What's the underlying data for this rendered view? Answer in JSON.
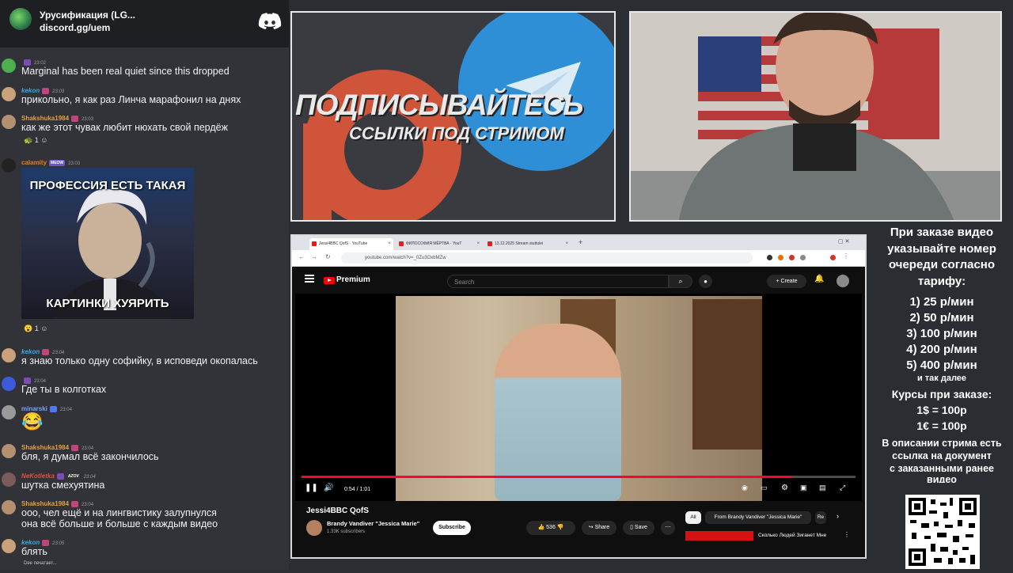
{
  "discord": {
    "server_name": "Урусификация (LG...",
    "server_link": "discord.gg/uem",
    "messages": [
      {
        "user": "",
        "time": "23:02",
        "text": "Marginal has been real quiet since this dropped",
        "user_color": "#3ba55d"
      },
      {
        "user": "kekon",
        "time": "23:03",
        "text": "прикольно, я как раз Линча марафонил на днях",
        "user_color": "#3aa7e6"
      },
      {
        "user": "Shakshuka1984",
        "time": "23:03",
        "text": "как же этот чувак любит нюхать свой пердёж",
        "user_color": "#e6a23a",
        "reaction_count": "1"
      },
      {
        "user": "calamity",
        "badge": "MEOW",
        "time": "23:03",
        "text": "",
        "user_color": "#e67e22",
        "reaction_count": "1"
      },
      {
        "user": "kekon",
        "time": "23:04",
        "text": "я знаю только одну софийку, в исповеди окопалась",
        "user_color": "#3aa7e6"
      },
      {
        "user": "",
        "time": "23:04",
        "text": "Где ты в колготках",
        "user_color": "#dcddde"
      },
      {
        "user": "minarski",
        "time": "23:04",
        "text": "😂",
        "user_color": "#7aa2ff"
      },
      {
        "user": "Shakshuka1984",
        "time": "23:04",
        "text": "бля, я думал всё закончилось",
        "user_color": "#e6a23a"
      },
      {
        "user": "NeKotletka",
        "badge": "AZOV",
        "time": "23:04",
        "text": "шутка смехуятина",
        "user_color": "#e74c3c"
      },
      {
        "user": "Shakshuka1984",
        "time": "23:04",
        "text": "ооо, чел ещё и на лингвистику залупнулся",
        "text2": "она всё больше и больше с каждым видео",
        "user_color": "#e6a23a"
      },
      {
        "user": "kekon",
        "time": "23:05",
        "text": "блять",
        "user_color": "#3aa7e6"
      }
    ],
    "meme": {
      "top_text": "ПРОФЕССИЯ ЕСТЬ ТАКАЯ",
      "bottom_text": "КАРТИНКИ ХУЯРИТЬ"
    },
    "typing": "Dee печатает..."
  },
  "banner": {
    "big_text": "ПОДПИСЫВАЙТЕСЬ",
    "small_text": "ССЫЛКИ ПОД СТРИМОМ"
  },
  "browser": {
    "tabs": [
      {
        "label": "Jessi4BBC QofS · YouTube"
      },
      {
        "label": "ФИЛОСОФИЯ МЁРТВА · YouT"
      },
      {
        "label": "13.12.2025 Stream stuttulei"
      }
    ],
    "url": "youtube.com/watch?v=_0Zu3OxbMZw",
    "youtube": {
      "brand": "Premium",
      "search_placeholder": "Search",
      "create_label": "Create",
      "time": "0:54 / 1:01",
      "progress": 0.885,
      "video_title": "Jessi4BBC QofS",
      "channel_name": "Brandy Vandiver \"Jessica Marie\"",
      "subscribers": "1.33K subscribers",
      "subscribe_label": "Subscribe",
      "likes": "536",
      "share_label": "Share",
      "save_label": "Save",
      "chips": [
        "All",
        "From Brandy Vandiver \"Jessica Marie\"",
        "Re"
      ],
      "rec_title": "Сколько Людей Зиганет Мне"
    }
  },
  "info_panel": {
    "header": [
      "При заказе видео",
      "указывайте номер",
      "очереди согласно",
      "тарифу:"
    ],
    "tariffs": [
      "1) 25 р/мин",
      "2) 50 р/мин",
      "3) 100 р/мин",
      "4) 200 р/мин",
      "5) 400 р/мин"
    ],
    "tariffs_note": "и так далее",
    "rates_title": "Курсы при заказе:",
    "rates": [
      "1$ = 100р",
      "1€ = 100р"
    ],
    "footer": [
      "В описании стрима есть",
      "ссылка на документ",
      "с заказанными ранее",
      "видео"
    ]
  },
  "colors": {
    "accent": "#ff0033",
    "discord_bg": "#313338",
    "banner_patreon": "#d0543a",
    "banner_telegram": "#2e8ed6"
  }
}
